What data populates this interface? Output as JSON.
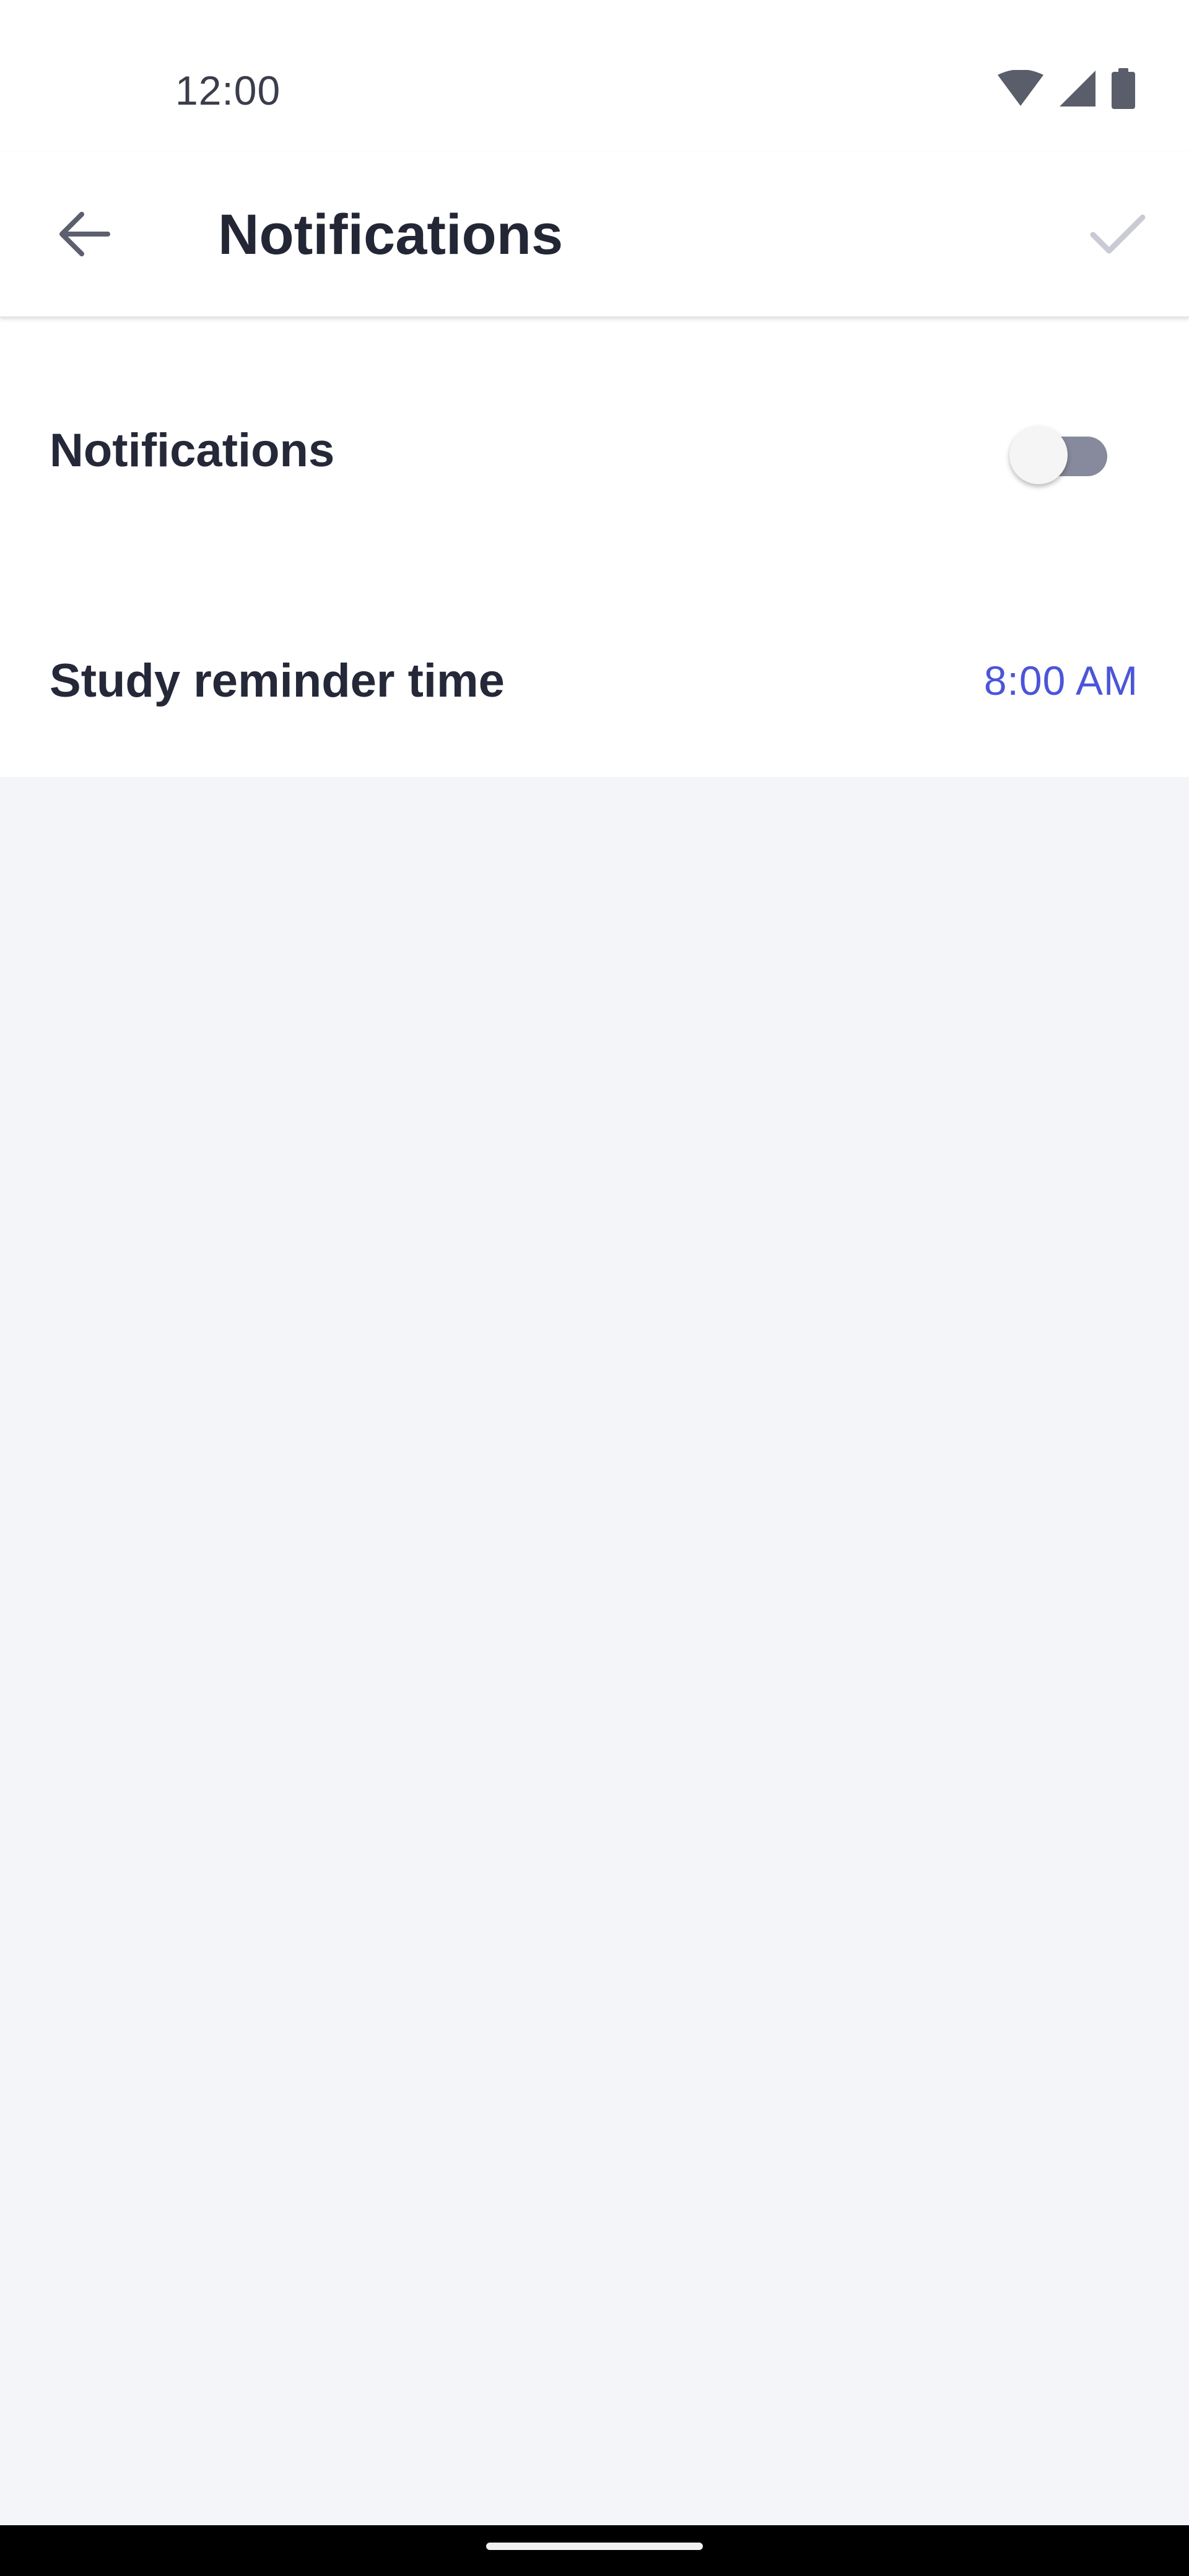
{
  "status_bar": {
    "time": "12:00",
    "icons": [
      "wifi-icon",
      "cellular-signal-icon",
      "battery-icon"
    ]
  },
  "app_bar": {
    "back_icon": "arrow-left-icon",
    "title": "Notifications",
    "confirm_icon": "checkmark-icon"
  },
  "settings": {
    "notifications": {
      "label": "Notifications",
      "enabled": false
    },
    "reminder": {
      "label": "Study reminder time",
      "value": "8:00 AM"
    }
  },
  "colors": {
    "accent": "#4b55d8",
    "text_primary": "#252838",
    "toggle_track_off": "#878a9c",
    "background": "#f4f5f9"
  }
}
